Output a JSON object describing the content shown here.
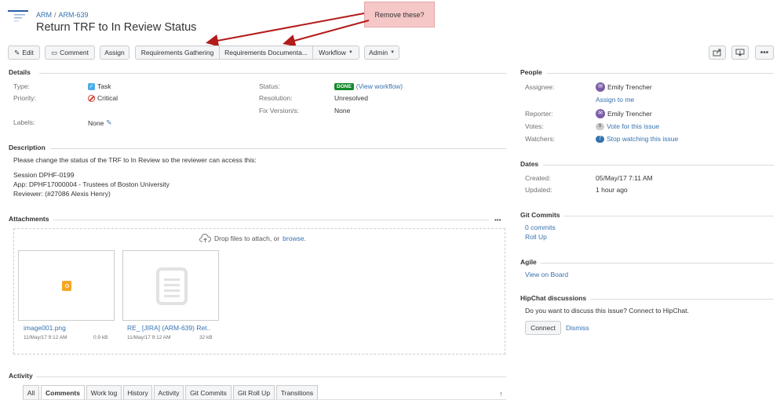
{
  "header": {
    "project": "ARM",
    "issue_key": "ARM-639",
    "title": "Return TRF to In Review Status"
  },
  "callout": {
    "text": "Remove these?"
  },
  "toolbar": {
    "edit": "Edit",
    "comment": "Comment",
    "assign": "Assign",
    "req_gathering": "Requirements Gathering",
    "req_documentation": "Requirements Documenta...",
    "workflow": "Workflow",
    "admin": "Admin"
  },
  "details": {
    "heading": "Details",
    "type_label": "Type:",
    "type_value": "Task",
    "priority_label": "Priority:",
    "priority_value": "Critical",
    "labels_label": "Labels:",
    "labels_value": "None",
    "status_label": "Status:",
    "status_value": "DONE",
    "view_workflow": "(View workflow)",
    "resolution_label": "Resolution:",
    "resolution_value": "Unresolved",
    "fix_label": "Fix Version/s:",
    "fix_value": "None"
  },
  "description": {
    "heading": "Description",
    "lines": [
      "Please change the status of the TRF to In Review so the reviewer can access this:",
      "Session DPHF-0199",
      "App: DPHF17000004 - Trustees of Boston University",
      "Reviewer: (#27086 Alexis Henry)"
    ]
  },
  "attachments": {
    "heading": "Attachments",
    "more": "•••",
    "drop_text": "Drop files to attach, or",
    "browse": "browse.",
    "files": [
      {
        "name": "image001.png",
        "date": "11/May/17 9:12 AM",
        "size": "0.9 kB"
      },
      {
        "name": "RE_ [JIRA] (ARM-639) Ret…",
        "date": "11/May/17 9:12 AM",
        "size": "32 kB"
      }
    ]
  },
  "activity": {
    "heading": "Activity",
    "tabs": [
      "All",
      "Comments",
      "Work log",
      "History",
      "Activity",
      "Git Commits",
      "Git Roll Up",
      "Transitions"
    ],
    "active_tab": "Comments"
  },
  "people": {
    "heading": "People",
    "assignee_label": "Assignee:",
    "assignee": "Emily Trencher",
    "assign_to_me": "Assign to me",
    "reporter_label": "Reporter:",
    "reporter": "Emily Trencher",
    "votes_label": "Votes:",
    "votes_count": "0",
    "vote_link": "Vote for this issue",
    "watchers_label": "Watchers:",
    "watchers_count": "7",
    "watch_link": "Stop watching this issue"
  },
  "dates": {
    "heading": "Dates",
    "created_label": "Created:",
    "created": "05/May/17 7:11 AM",
    "updated_label": "Updated:",
    "updated": "1 hour ago"
  },
  "git": {
    "heading": "Git Commits",
    "commits": "0 commits",
    "rollup": "Roll Up"
  },
  "agile": {
    "heading": "Agile",
    "board": "View on Board"
  },
  "hipchat": {
    "heading": "HipChat discussions",
    "prompt": "Do you want to discuss this issue? Connect to HipChat.",
    "connect": "Connect",
    "dismiss": "Dismiss"
  },
  "colors": {
    "link": "#3572b0",
    "done": "#14892c",
    "critical": "#d04437",
    "callout_bg": "#f5c7c7",
    "arrow": "#b31b1b"
  }
}
